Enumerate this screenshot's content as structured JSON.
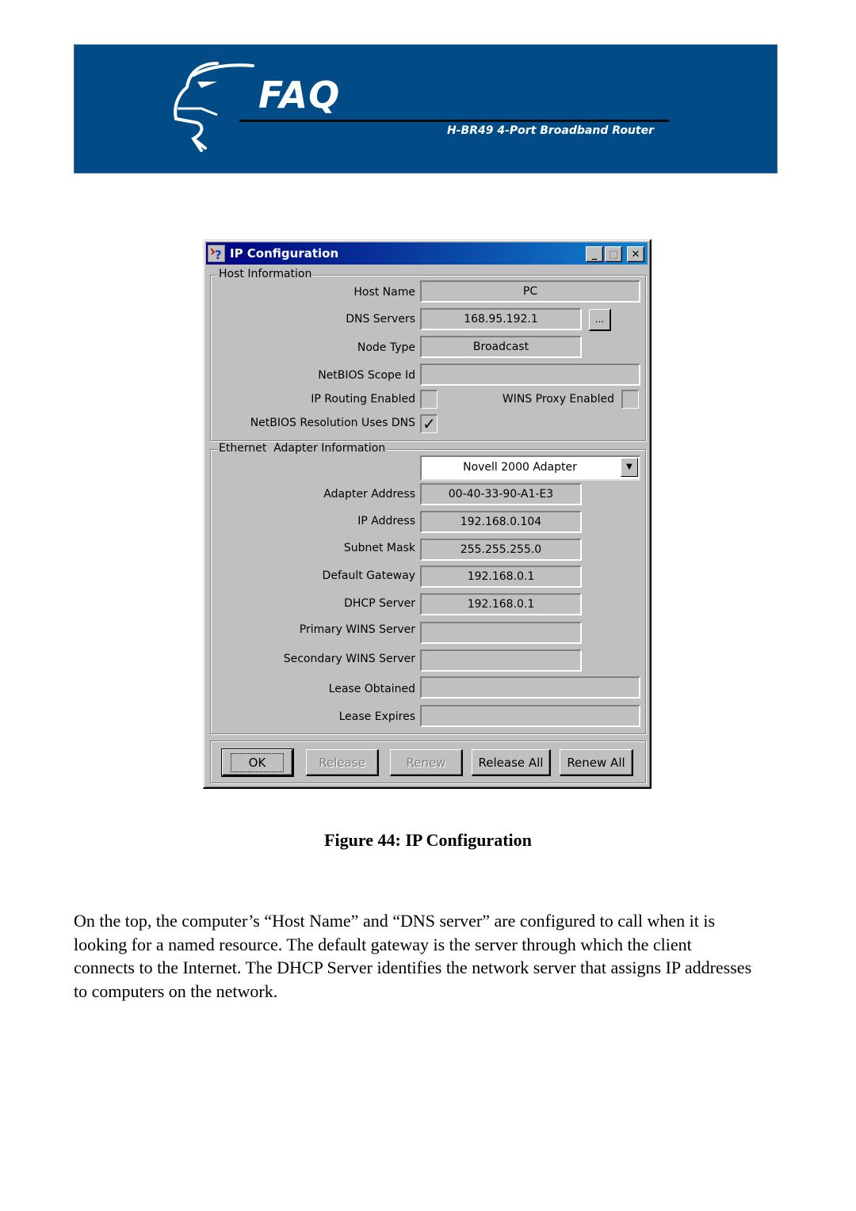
{
  "banner": {
    "logo_icon": "eagle-head-logo",
    "title": "FAQ",
    "subtitle": "H-BR49 4-Port Broadband Router",
    "background_color": "#014c86"
  },
  "dialog": {
    "title": "IP Configuration",
    "app_icon": "ip-config-icon",
    "window_buttons": {
      "minimize": "_",
      "maximize": "□",
      "close": "✕"
    },
    "host_info": {
      "group_label": "Host Information",
      "host_name_label": "Host Name",
      "host_name_value": "PC",
      "dns_servers_label": "DNS Servers",
      "dns_servers_value": "168.95.192.1",
      "dns_more_button": "...",
      "node_type_label": "Node Type",
      "node_type_value": "Broadcast",
      "netbios_scope_label": "NetBIOS Scope Id",
      "netbios_scope_value": "",
      "ip_routing_label": "IP Routing Enabled",
      "ip_routing_checked": false,
      "wins_proxy_label": "WINS Proxy Enabled",
      "wins_proxy_checked": false,
      "netbios_dns_label": "NetBIOS Resolution Uses DNS",
      "netbios_dns_checked": true,
      "check_glyph": "✓"
    },
    "adapter_info": {
      "group_label": "Ethernet  Adapter Information",
      "adapter_selected": "Novell 2000 Adapter",
      "dropdown_arrow": "▼",
      "fields": [
        {
          "label": "Adapter Address",
          "value": "00-40-33-90-A1-E3"
        },
        {
          "label": "IP Address",
          "value": "192.168.0.104"
        },
        {
          "label": "Subnet Mask",
          "value": "255.255.255.0"
        },
        {
          "label": "Default Gateway",
          "value": "192.168.0.1"
        },
        {
          "label": "DHCP Server",
          "value": "192.168.0.1"
        },
        {
          "label": "Primary WINS Server",
          "value": ""
        },
        {
          "label": "Secondary WINS Server",
          "value": ""
        },
        {
          "label": "Lease Obtained",
          "value": ""
        },
        {
          "label": "Lease Expires",
          "value": ""
        }
      ]
    },
    "buttons": {
      "ok": "OK",
      "release": "Release",
      "renew": "Renew",
      "release_all": "Release All",
      "renew_all": "Renew All"
    }
  },
  "caption": "Figure 44: IP Configuration",
  "paragraph": "On the top, the computer’s  “Host Name” and “DNS server” are configured to call when it is looking for a named resource. The default gateway is the server through which the client connects to the Internet. The DHCP Server identifies the network server that assigns IP addresses to computers on the network."
}
